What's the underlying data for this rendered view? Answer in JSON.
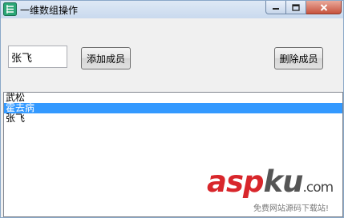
{
  "window": {
    "title": "一维数组操作",
    "icons": {
      "app": "app-grid-icon",
      "minimize": "minimize-icon",
      "maximize": "maximize-icon",
      "close": "close-icon"
    },
    "close_color": "#c7533e"
  },
  "form": {
    "name_input_value": "张飞",
    "add_label": "添加成员",
    "delete_label": "删除成员"
  },
  "list": {
    "items": [
      "武松",
      "霍去病",
      "张飞"
    ],
    "selected_index": 1,
    "selection_color": "#3399ff"
  },
  "watermark": {
    "logo_a": "asp",
    "logo_b": "ku",
    "logo_c": ".com",
    "subtitle": "免费网站源码下载站!"
  }
}
